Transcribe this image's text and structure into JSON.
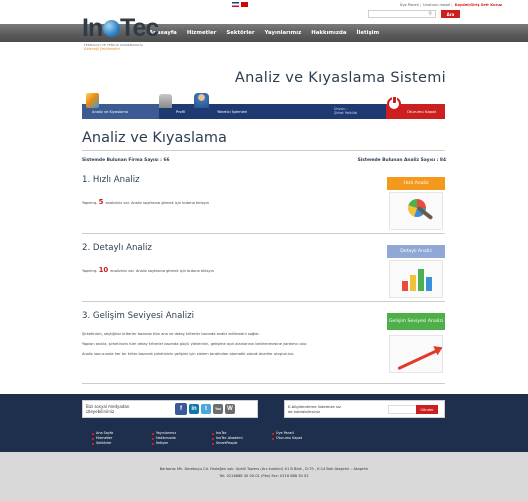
{
  "topbar": {
    "links": [
      "Üye Paneli",
      "Unutunu mosel",
      "Kaydet/Giriş",
      "Sefr Kuruz"
    ],
    "search_button": "Ara"
  },
  "logo": {
    "name": "InoTec",
    "tagline_small": "TEKNOLOJİ VE YENİLİK DANIŞMANLIĞI",
    "tagline": "Geleceği Şekillendirir"
  },
  "nav": {
    "items": [
      "Anasayfa",
      "Hizmetler",
      "Sektörler",
      "Yayınlarımız",
      "Hakkımızda",
      "İletişim"
    ]
  },
  "hero": {
    "title": "Analiz ve Kıyaslama Sistemi"
  },
  "modules": {
    "tabs": [
      "Analiz ve Kıyaslama",
      "Profil",
      "Yönetici İşlemleri"
    ],
    "user_label": "Ünvan :",
    "user_name": "Şirket Yetkilisi",
    "logout": "Oturumu Kapat"
  },
  "page": {
    "heading": "Analiz ve Kıyaslama",
    "firm_count_label": "Sistemde Bulunan Firma Sayısı : 66",
    "analysis_count_label": "Sistemde Bulunan Analiz Sayısı : 84"
  },
  "sections": [
    {
      "title": "1. Hızlı Analiz",
      "desc_before": "Yapılmış",
      "count": "5",
      "desc_after": "analiziniz var. Analiz sayfasına gitmek için butona tıklayın",
      "button": "Hızlı Analiz"
    },
    {
      "title": "2. Detaylı Analiz",
      "desc_before": "Yapılmış",
      "count": "10",
      "desc_after": "analiziniz var. Analiz sayfasına gitmek için butona tıklayın",
      "button": "Detaylı Analiz"
    },
    {
      "title": "3. Gelişim Seviyesi Analizi",
      "lines": [
        "Şirketinizin, seçtiğiniz kriterler bazında tüm ana ve detay kriterler bazında analiz edilmesini sağlar.",
        "Yapılan analiz, şirketinizin tüm detay kriterler bazında güçlü yönlerinin, gelişime açık alanlarının belirlenmesine yardımcı olur.",
        "Analiz sonucunda her bir kriter bazında şirketinizin gelişimi için sistem tarafından otomatik olarak öneriler oluşturulur."
      ],
      "button": "Gelişim Seviyesi Analizi"
    }
  ],
  "footer": {
    "social_text": "Bizi sosyal medyadan izleyebilirsiniz",
    "social_icons": [
      "facebook-icon",
      "linkedin-icon",
      "twitter-icon",
      "youtube-icon",
      "wordpress-icon"
    ],
    "newsletter_text": "E-bilgilendirme listemize siz de katılabilirsiniz",
    "newsletter_placeholder": "",
    "newsletter_button": "Gönder",
    "columns": [
      [
        "Ana Sayfa",
        "Hizmetler",
        "Sektörler"
      ],
      [
        "Yayınlarımız",
        "Hakkımızda",
        "İletişim"
      ],
      [
        "InoTec",
        "InoTec Akademi",
        "SmartPeople"
      ],
      [
        "Üye Paneli",
        "Oturumu Kapat"
      ]
    ],
    "address": "Barbaros Mh. Dereboyu Cd. Fesleğen sok. Uphill Towers (Arz kuleleri) A1 B Blok , D:79 , K:14 Batı Ataşehir – Ataşehir",
    "phone": "Tel: 0216688 30 00-01 (Pbx) Fax: 0216 688 30 02"
  }
}
